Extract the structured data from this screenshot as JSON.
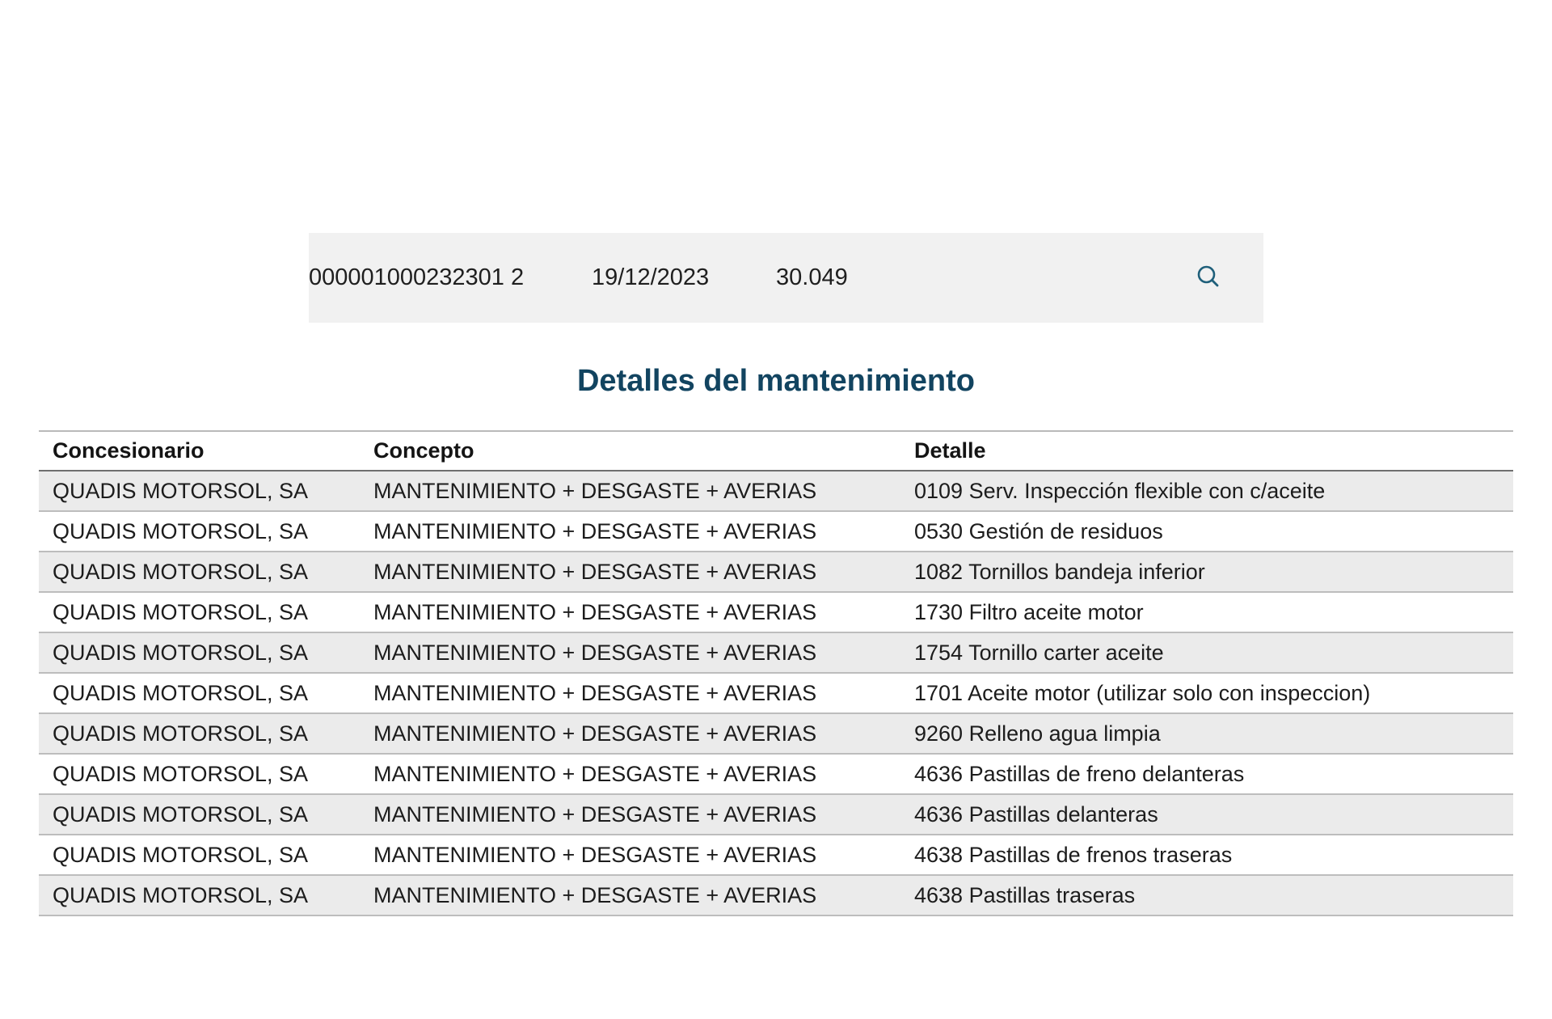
{
  "summary": {
    "id": "000001000232301 2",
    "date": "19/12/2023",
    "amount": "30.049",
    "search_icon": "search-icon"
  },
  "section_title": "Detalles del mantenimiento",
  "table": {
    "headers": [
      "Concesionario",
      "Concepto",
      "Detalle"
    ],
    "rows": [
      [
        "QUADIS MOTORSOL, SA",
        "MANTENIMIENTO + DESGASTE + AVERIAS",
        "0109 Serv. Inspección flexible con c/aceite"
      ],
      [
        "QUADIS MOTORSOL, SA",
        "MANTENIMIENTO + DESGASTE + AVERIAS",
        "0530 Gestión de residuos"
      ],
      [
        "QUADIS MOTORSOL, SA",
        "MANTENIMIENTO + DESGASTE + AVERIAS",
        "1082 Tornillos bandeja inferior"
      ],
      [
        "QUADIS MOTORSOL, SA",
        "MANTENIMIENTO + DESGASTE + AVERIAS",
        "1730 Filtro aceite motor"
      ],
      [
        "QUADIS MOTORSOL, SA",
        "MANTENIMIENTO + DESGASTE + AVERIAS",
        "1754 Tornillo carter aceite"
      ],
      [
        "QUADIS MOTORSOL, SA",
        "MANTENIMIENTO + DESGASTE + AVERIAS",
        "1701 Aceite motor (utilizar solo con inspeccion)"
      ],
      [
        "QUADIS MOTORSOL, SA",
        "MANTENIMIENTO + DESGASTE + AVERIAS",
        "9260 Relleno agua limpia"
      ],
      [
        "QUADIS MOTORSOL, SA",
        "MANTENIMIENTO + DESGASTE + AVERIAS",
        "4636 Pastillas de freno delanteras"
      ],
      [
        "QUADIS MOTORSOL, SA",
        "MANTENIMIENTO + DESGASTE + AVERIAS",
        "4636 Pastillas delanteras"
      ],
      [
        "QUADIS MOTORSOL, SA",
        "MANTENIMIENTO + DESGASTE + AVERIAS",
        "4638 Pastillas de frenos traseras"
      ],
      [
        "QUADIS MOTORSOL, SA",
        "MANTENIMIENTO + DESGASTE + AVERIAS",
        "4638 Pastillas traseras"
      ]
    ]
  },
  "colors": {
    "title": "#124460",
    "icon": "#1f5f7a",
    "summary_bg": "#f1f1f1",
    "row_shade": "#ebebeb"
  }
}
